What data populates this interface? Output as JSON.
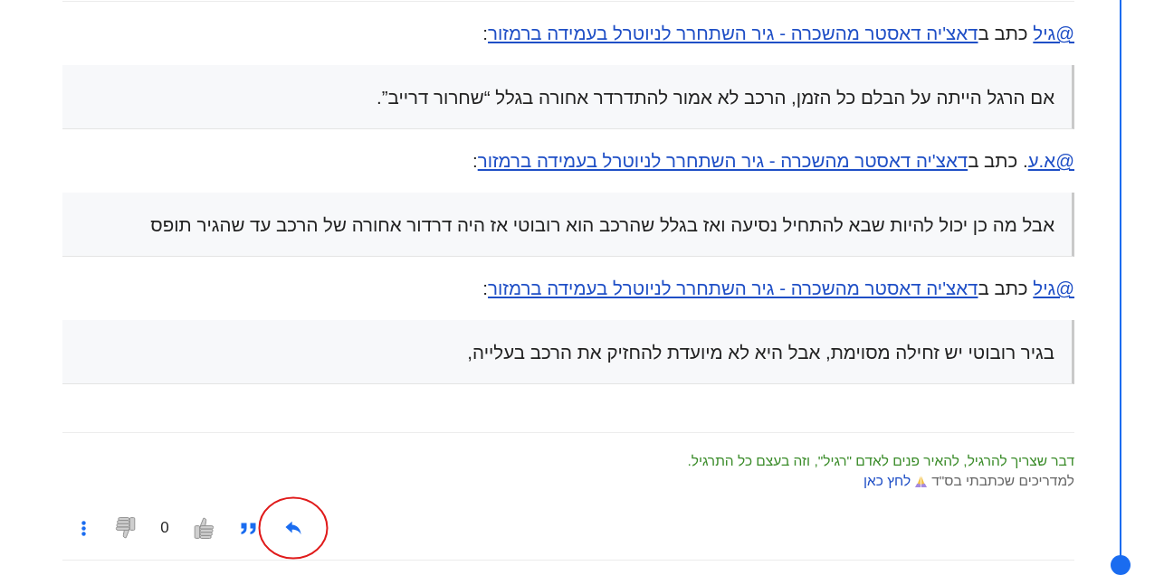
{
  "quotes": [
    {
      "author": "@גיל",
      "connector": " כתב ב",
      "topic": "דאצ'יה דאסטר מהשכרה - גיר השתחרר לניוטרל בעמידה ברמזור",
      "end": ":",
      "text": "אם הרגל הייתה על הבלם כל הזמן, הרכב לא אמור להתדרדר אחורה בגלל “שחרור דרייב”."
    },
    {
      "author": "@א.ע",
      "connector": ". כתב ב",
      "topic": "דאצ'יה דאסטר מהשכרה - גיר השתחרר לניוטרל בעמידה ברמזור",
      "end": ":",
      "text": "אבל מה כן יכול להיות שבא להתחיל נסיעה ואז בגלל שהרכב הוא רובוטי אז היה דרדור אחורה של הרכב עד שהגיר תופס"
    },
    {
      "author": "@גיל",
      "connector": " כתב ב",
      "topic": "דאצ'יה דאסטר מהשכרה - גיר השתחרר לניוטרל בעמידה ברמזור",
      "end": ":",
      "text": "בגיר רובוטי יש זחילה מסוימת, אבל היא לא מיועדת להחזיק את הרכב בעלייה,"
    }
  ],
  "signature": {
    "motto": "דבר שצריך להרגיל, להאיר פנים לאדם \"רגיל\", וזה בעצם כל התרגיל.",
    "note": "למדריכים שכתבתי בס\"ד",
    "link": "לחץ כאן"
  },
  "actions": {
    "like_count": "0",
    "reply_circled": true
  }
}
